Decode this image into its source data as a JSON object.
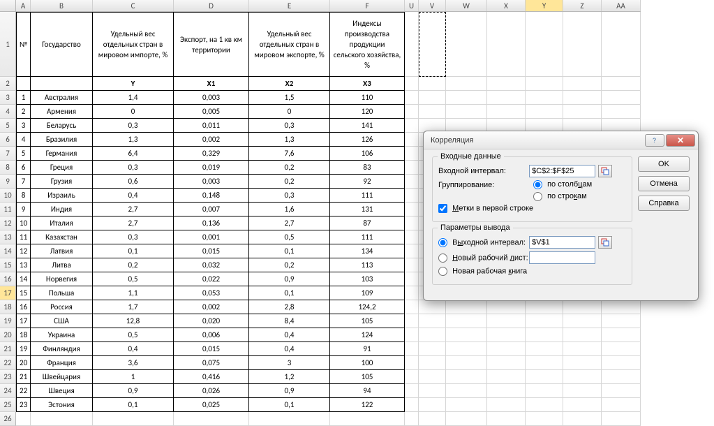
{
  "columns": [
    {
      "id": "A",
      "w": "w-A",
      "label": "A"
    },
    {
      "id": "B",
      "w": "w-B",
      "label": "B"
    },
    {
      "id": "C",
      "w": "w-C",
      "label": "C"
    },
    {
      "id": "D",
      "w": "w-D",
      "label": "D"
    },
    {
      "id": "E",
      "w": "w-E",
      "label": "E"
    },
    {
      "id": "F",
      "w": "w-F",
      "label": "F"
    },
    {
      "id": "U",
      "w": "w-U",
      "label": "U"
    },
    {
      "id": "V",
      "w": "w-V",
      "label": "V"
    },
    {
      "id": "W",
      "w": "w-W",
      "label": "W"
    },
    {
      "id": "X",
      "w": "w-X",
      "label": "X"
    },
    {
      "id": "Y",
      "w": "w-Y",
      "label": "Y"
    },
    {
      "id": "Z",
      "w": "w-Z",
      "label": "Z"
    },
    {
      "id": "AA",
      "w": "w-AA",
      "label": "AA"
    }
  ],
  "header_row": {
    "A": "№",
    "B": "Государство",
    "C": "Удельный вес отдельных стран в мировом импорте, %",
    "D": "Экспорт, на 1 кв км территории",
    "E": "Удельный вес отдельных стран в мировом экспорте, %",
    "F": "Индексы производства продукции сельского хозяйства, %"
  },
  "var_row": {
    "C": "Y",
    "D": "X1",
    "E": "X2",
    "F": "X3"
  },
  "rows": [
    {
      "n": "1",
      "state": "Австралия",
      "c": "1,4",
      "d": "0,003",
      "e": "1,5",
      "f": "110"
    },
    {
      "n": "2",
      "state": "Армения",
      "c": "0",
      "d": "0,005",
      "e": "0",
      "f": "120"
    },
    {
      "n": "3",
      "state": "Беларусь",
      "c": "0,3",
      "d": "0,011",
      "e": "0,3",
      "f": "141"
    },
    {
      "n": "4",
      "state": "Бразилия",
      "c": "1,3",
      "d": "0,002",
      "e": "1,3",
      "f": "126"
    },
    {
      "n": "5",
      "state": "Германия",
      "c": "6,4",
      "d": "0,329",
      "e": "7,6",
      "f": "106"
    },
    {
      "n": "6",
      "state": "Греция",
      "c": "0,3",
      "d": "0,019",
      "e": "0,2",
      "f": "83"
    },
    {
      "n": "7",
      "state": "Грузия",
      "c": "0,6",
      "d": "0,003",
      "e": "0,2",
      "f": "92"
    },
    {
      "n": "8",
      "state": "Израиль",
      "c": "0,4",
      "d": "0,148",
      "e": "0,3",
      "f": "111"
    },
    {
      "n": "9",
      "state": "Индия",
      "c": "2,7",
      "d": "0,007",
      "e": "1,6",
      "f": "131"
    },
    {
      "n": "10",
      "state": "Италия",
      "c": "2,7",
      "d": "0,136",
      "e": "2,7",
      "f": "87"
    },
    {
      "n": "11",
      "state": "Казахстан",
      "c": "0,3",
      "d": "0,001",
      "e": "0,5",
      "f": "111"
    },
    {
      "n": "12",
      "state": "Латвия",
      "c": "0,1",
      "d": "0,015",
      "e": "0,1",
      "f": "134"
    },
    {
      "n": "13",
      "state": "Литва",
      "c": "0,2",
      "d": "0,032",
      "e": "0,2",
      "f": "113"
    },
    {
      "n": "14",
      "state": "Норвегия",
      "c": "0,5",
      "d": "0,022",
      "e": "0,9",
      "f": "103"
    },
    {
      "n": "15",
      "state": "Польша",
      "c": "1,1",
      "d": "0,053",
      "e": "0,1",
      "f": "109"
    },
    {
      "n": "16",
      "state": "Россия",
      "c": "1,7",
      "d": "0,002",
      "e": "2,8",
      "f": "124,2"
    },
    {
      "n": "17",
      "state": "США",
      "c": "12,8",
      "d": "0,020",
      "e": "8,4",
      "f": "105"
    },
    {
      "n": "18",
      "state": "Украина",
      "c": "0,5",
      "d": "0,006",
      "e": "0,4",
      "f": "124"
    },
    {
      "n": "19",
      "state": "Финляндия",
      "c": "0,4",
      "d": "0,015",
      "e": "0,4",
      "f": "91"
    },
    {
      "n": "20",
      "state": "Франция",
      "c": "3,6",
      "d": "0,075",
      "e": "3",
      "f": "100"
    },
    {
      "n": "21",
      "state": "Швейцария",
      "c": "1",
      "d": "0,416",
      "e": "1,2",
      "f": "105"
    },
    {
      "n": "22",
      "state": "Швеция",
      "c": "0,9",
      "d": "0,026",
      "e": "0,9",
      "f": "94"
    },
    {
      "n": "23",
      "state": "Эстония",
      "c": "0,1",
      "d": "0,025",
      "e": "0,1",
      "f": "122"
    }
  ],
  "active_row_header": "17",
  "active_col_header": "Y",
  "dialog": {
    "title": "Корреляция",
    "buttons": {
      "ok": "OK",
      "cancel": "Отмена",
      "help": "Справка"
    },
    "group_input": "Входные данные",
    "input_range_label": "Входной интервал:",
    "input_range_value": "$C$2:$F$25",
    "grouping_label": "Группирование:",
    "grouping_cols": "по столбцам",
    "grouping_rows": "по строкам",
    "labels_first_row": "Метки в первой строке",
    "group_output": "Параметры вывода",
    "output_range_label": "Выходной интервал:",
    "output_range_value": "$V$1",
    "new_sheet_label": "Новый рабочий лист:",
    "new_book_label": "Новая рабочая книга",
    "grouping_cols_u": "ц",
    "grouping_rows_u": "к",
    "labels_u": "М",
    "output_range_u": "ы",
    "new_sheet_u": "Н",
    "new_book_u": "я"
  },
  "chart_data": {
    "type": "table",
    "title": "Корреляция – исходные данные",
    "columns": [
      "Y",
      "X1",
      "X2",
      "X3"
    ],
    "column_labels": {
      "Y": "Удельный вес отдельных стран в мировом импорте, %",
      "X1": "Экспорт, на 1 кв км территории",
      "X2": "Удельный вес отдельных стран в мировом экспорте, %",
      "X3": "Индексы производства продукции сельского хозяйства, %"
    },
    "row_labels": [
      "Австралия",
      "Армения",
      "Беларусь",
      "Бразилия",
      "Германия",
      "Греция",
      "Грузия",
      "Израиль",
      "Индия",
      "Италия",
      "Казахстан",
      "Латвия",
      "Литва",
      "Норвегия",
      "Польша",
      "Россия",
      "США",
      "Украина",
      "Финляндия",
      "Франция",
      "Швейцария",
      "Швеция",
      "Эстония"
    ],
    "data": {
      "Y": [
        1.4,
        0,
        0.3,
        1.3,
        6.4,
        0.3,
        0.6,
        0.4,
        2.7,
        2.7,
        0.3,
        0.1,
        0.2,
        0.5,
        1.1,
        1.7,
        12.8,
        0.5,
        0.4,
        3.6,
        1,
        0.9,
        0.1
      ],
      "X1": [
        0.003,
        0.005,
        0.011,
        0.002,
        0.329,
        0.019,
        0.003,
        0.148,
        0.007,
        0.136,
        0.001,
        0.015,
        0.032,
        0.022,
        0.053,
        0.002,
        0.02,
        0.006,
        0.015,
        0.075,
        0.416,
        0.026,
        0.025
      ],
      "X2": [
        1.5,
        0,
        0.3,
        1.3,
        7.6,
        0.2,
        0.2,
        0.3,
        1.6,
        2.7,
        0.5,
        0.1,
        0.2,
        0.9,
        0.1,
        2.8,
        8.4,
        0.4,
        0.4,
        3,
        1.2,
        0.9,
        0.1
      ],
      "X3": [
        110,
        120,
        141,
        126,
        106,
        83,
        92,
        111,
        131,
        87,
        111,
        134,
        113,
        103,
        109,
        124.2,
        105,
        124,
        91,
        100,
        105,
        94,
        122
      ]
    }
  }
}
